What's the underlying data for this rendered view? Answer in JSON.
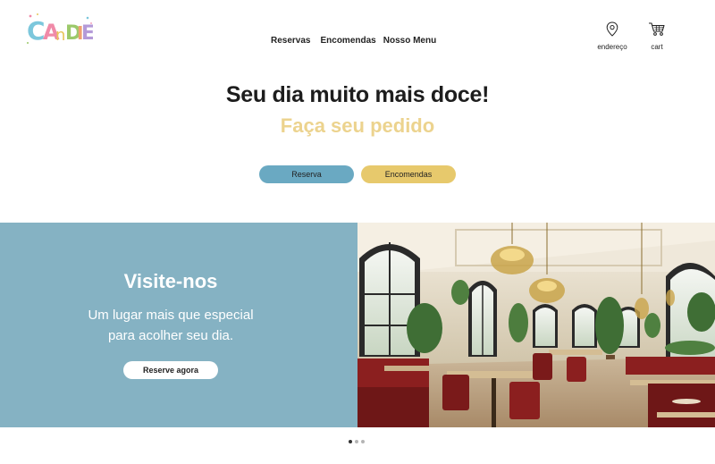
{
  "brand": {
    "logo_text": "CANDIE"
  },
  "nav": {
    "items": [
      {
        "label": "Reservas"
      },
      {
        "label": "Encomendas"
      },
      {
        "label": "Nosso Menu"
      }
    ]
  },
  "header_actions": {
    "address_label": "endereço",
    "address_icon": "location-pin-icon",
    "cart_label": "cart",
    "cart_icon": "shopping-cart-icon"
  },
  "hero": {
    "title": "Seu dia muito mais doce!",
    "subtitle": "Faça seu pedido",
    "buttons": {
      "reserva": "Reserva",
      "encomendas": "Encomendas"
    }
  },
  "banner": {
    "title": "Visite-nos",
    "line1": "Um lugar mais que especial",
    "line2": "para acolher seu dia.",
    "cta": "Reserve agora"
  },
  "carousel": {
    "slides": 3,
    "active": 1
  },
  "colors": {
    "accent_blue": "#6aa9c2",
    "accent_yellow": "#e7c96c",
    "subtitle_yellow": "#ecd38e",
    "banner_blue": "#85b2c3"
  }
}
